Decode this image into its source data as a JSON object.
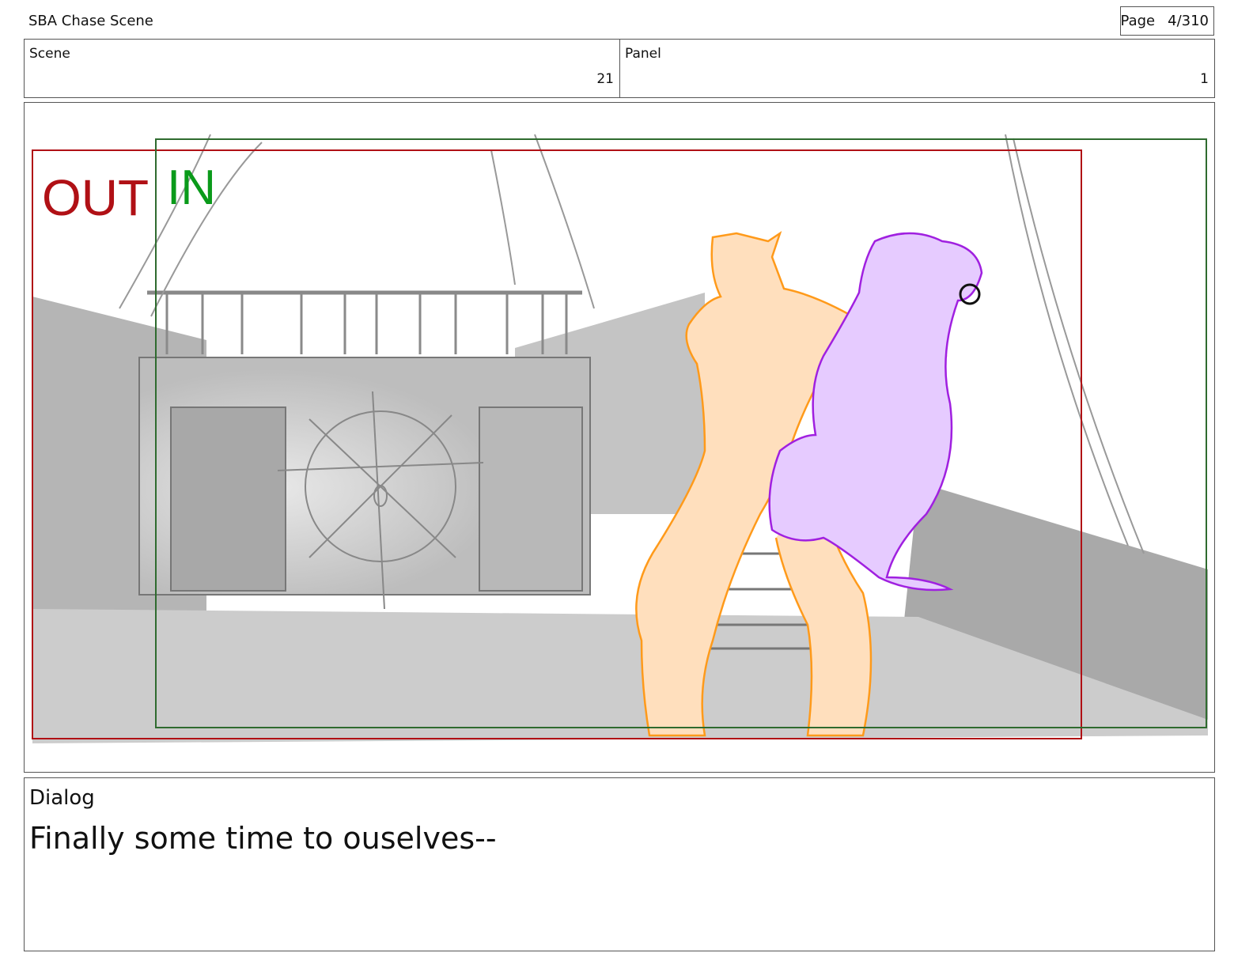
{
  "document": {
    "title": "SBA Chase Scene"
  },
  "page": {
    "label": "Page",
    "number": "4/310"
  },
  "scene": {
    "label": "Scene",
    "value": "21"
  },
  "panel": {
    "label": "Panel",
    "value": "1"
  },
  "frame": {
    "out_label": "OUT",
    "in_label": "IN",
    "colors": {
      "out": "#b01015",
      "in": "#0a9a1a",
      "orange_char": "#ff9a1a",
      "purple_char": "#a020e0"
    }
  },
  "dialog": {
    "label": "Dialog",
    "text": "Finally some time to ouselves--"
  }
}
